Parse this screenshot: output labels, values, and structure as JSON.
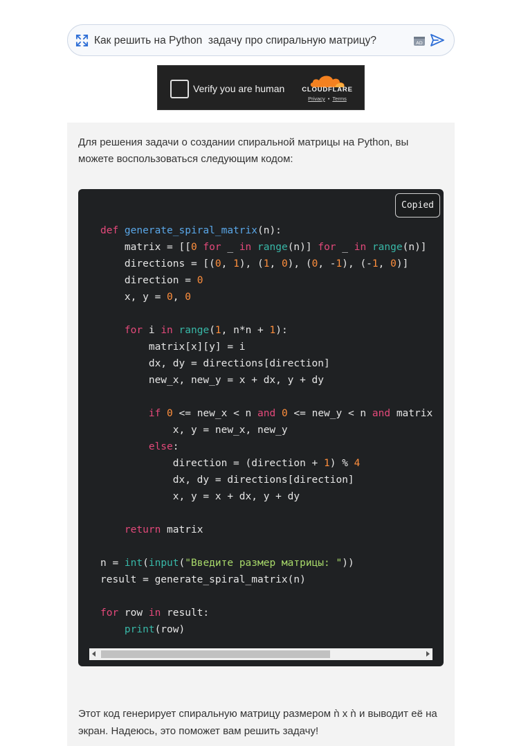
{
  "search": {
    "query": "Как решить на Python  задачу про спиральную матрицу?"
  },
  "captcha": {
    "label": "Verify you are human",
    "brand": "CLOUDFLARE",
    "privacy": "Privacy",
    "separator": "•",
    "terms": "Terms"
  },
  "answer": {
    "intro": "Для решения задачи о создании спиральной матрицы на Python, вы можете воспользоваться следующим кодом:",
    "copy_label": "Copied",
    "code_lines": [
      [
        [
          "kw",
          "def "
        ],
        [
          "fn",
          "generate_spiral_matrix"
        ],
        [
          "txt",
          "(n):"
        ]
      ],
      [
        [
          "txt",
          "    matrix = [["
        ],
        [
          "num",
          "0"
        ],
        [
          "txt",
          " "
        ],
        [
          "kw",
          "for"
        ],
        [
          "txt",
          " _ "
        ],
        [
          "kw",
          "in"
        ],
        [
          "txt",
          " "
        ],
        [
          "bi",
          "range"
        ],
        [
          "txt",
          "(n)] "
        ],
        [
          "kw",
          "for"
        ],
        [
          "txt",
          " _ "
        ],
        [
          "kw",
          "in"
        ],
        [
          "txt",
          " "
        ],
        [
          "bi",
          "range"
        ],
        [
          "txt",
          "(n)]"
        ]
      ],
      [
        [
          "txt",
          "    directions = [("
        ],
        [
          "num",
          "0"
        ],
        [
          "txt",
          ", "
        ],
        [
          "num",
          "1"
        ],
        [
          "txt",
          "), ("
        ],
        [
          "num",
          "1"
        ],
        [
          "txt",
          ", "
        ],
        [
          "num",
          "0"
        ],
        [
          "txt",
          "), ("
        ],
        [
          "num",
          "0"
        ],
        [
          "txt",
          ", -"
        ],
        [
          "num",
          "1"
        ],
        [
          "txt",
          "), (-"
        ],
        [
          "num",
          "1"
        ],
        [
          "txt",
          ", "
        ],
        [
          "num",
          "0"
        ],
        [
          "txt",
          ")]"
        ]
      ],
      [
        [
          "txt",
          "    direction = "
        ],
        [
          "num",
          "0"
        ]
      ],
      [
        [
          "txt",
          "    x, y = "
        ],
        [
          "num",
          "0"
        ],
        [
          "txt",
          ", "
        ],
        [
          "num",
          "0"
        ]
      ],
      [
        [
          "txt",
          ""
        ]
      ],
      [
        [
          "txt",
          "    "
        ],
        [
          "kw",
          "for"
        ],
        [
          "txt",
          " i "
        ],
        [
          "kw",
          "in"
        ],
        [
          "txt",
          " "
        ],
        [
          "bi",
          "range"
        ],
        [
          "txt",
          "("
        ],
        [
          "num",
          "1"
        ],
        [
          "txt",
          ", n*n + "
        ],
        [
          "num",
          "1"
        ],
        [
          "txt",
          "):"
        ]
      ],
      [
        [
          "txt",
          "        matrix[x][y] = i"
        ]
      ],
      [
        [
          "txt",
          "        dx, dy = directions[direction]"
        ]
      ],
      [
        [
          "txt",
          "        new_x, new_y = x + dx, y + dy"
        ]
      ],
      [
        [
          "txt",
          ""
        ]
      ],
      [
        [
          "txt",
          "        "
        ],
        [
          "kw",
          "if"
        ],
        [
          "txt",
          " "
        ],
        [
          "num",
          "0"
        ],
        [
          "txt",
          " <= new_x < n "
        ],
        [
          "kw",
          "and"
        ],
        [
          "txt",
          " "
        ],
        [
          "num",
          "0"
        ],
        [
          "txt",
          " <= new_y < n "
        ],
        [
          "kw",
          "and"
        ],
        [
          "txt",
          " matrix"
        ]
      ],
      [
        [
          "txt",
          "            x, y = new_x, new_y"
        ]
      ],
      [
        [
          "txt",
          "        "
        ],
        [
          "kw",
          "else"
        ],
        [
          "txt",
          ":"
        ]
      ],
      [
        [
          "txt",
          "            direction = (direction + "
        ],
        [
          "num",
          "1"
        ],
        [
          "txt",
          ") % "
        ],
        [
          "num",
          "4"
        ]
      ],
      [
        [
          "txt",
          "            dx, dy = directions[direction]"
        ]
      ],
      [
        [
          "txt",
          "            x, y = x + dx, y + dy"
        ]
      ],
      [
        [
          "txt",
          ""
        ]
      ],
      [
        [
          "txt",
          "    "
        ],
        [
          "kw",
          "return"
        ],
        [
          "txt",
          " matrix"
        ]
      ],
      [
        [
          "txt",
          ""
        ]
      ],
      [
        [
          "txt",
          "n = "
        ],
        [
          "bi",
          "int"
        ],
        [
          "txt",
          "("
        ],
        [
          "bi",
          "input"
        ],
        [
          "txt",
          "("
        ],
        [
          "str",
          "\"Введите размер матрицы: \""
        ],
        [
          "txt",
          "))"
        ]
      ],
      [
        [
          "txt",
          "result = generate_spiral_matrix(n)"
        ]
      ],
      [
        [
          "txt",
          ""
        ]
      ],
      [
        [
          "kw",
          "for"
        ],
        [
          "txt",
          " row "
        ],
        [
          "kw",
          "in"
        ],
        [
          "txt",
          " result:"
        ]
      ],
      [
        [
          "txt",
          "    "
        ],
        [
          "bi",
          "print"
        ],
        [
          "txt",
          "(row)"
        ]
      ]
    ],
    "outro": "Этот код генерирует спиральную матрицу размером ǹ x ǹ и выводит её на экран. Надеюсь, это поможет вам решить задачу!"
  },
  "colors": {
    "keyword": "#e3497a",
    "function": "#5aa7e8",
    "builtin": "#38b8a8",
    "number": "#ff8f3d",
    "string": "#a8d96a",
    "code_bg": "#1f2123"
  },
  "icons": [
    "expand-icon",
    "ad-block-icon",
    "send-icon",
    "checkbox-icon",
    "cloudflare-logo-icon"
  ]
}
